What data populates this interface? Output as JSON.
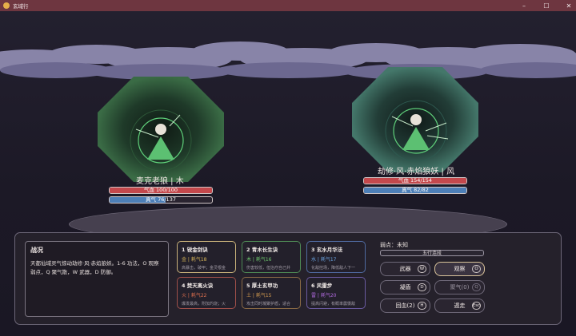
{
  "window": {
    "title": "玄域行",
    "minimize": "–",
    "maximize": "☐",
    "close": "✕"
  },
  "player": {
    "name": "麦克老狼 | 木",
    "hp_text": "气血 100/100",
    "hp_fraction": 1.0,
    "qi_text": "真气 76/137",
    "qi_fraction": 0.55,
    "hp_color": "#c3484c",
    "qi_color": "#4d7fb7",
    "aura_color": "#315b3d"
  },
  "enemy": {
    "name": "劫修·风·赤焰狼妖 | 风",
    "hp_text": "气血 154/154",
    "hp_fraction": 1.0,
    "qi_text": "真气 82/82",
    "qi_fraction": 1.0,
    "hp_color": "#c3484c",
    "qi_color": "#4d7fb7",
    "aura_color": "#3c6a60"
  },
  "log": {
    "title": "战况",
    "text": "天都仙域灵气惊动劫修·风·赤焰狼妖。1-6 功法，O 观察弱点，Q 聚气散，W 武器，D 防御。"
  },
  "skills": [
    {
      "name": "1 锐金剑诀",
      "cost": "金 | 耗气18",
      "desc": "高暴击，破甲；金灵根金",
      "cost_color": "#d8b65a",
      "border": "#c9b27a"
    },
    {
      "name": "2 青木长生诀",
      "cost": "木 | 耗气16",
      "desc": "伤害较低，但治疗自己并",
      "cost_color": "#6fca6f",
      "border": "#4e8a55"
    },
    {
      "name": "3 玄水月华法",
      "cost": "水 | 耗气17",
      "desc": "化敌控场，降低敌人下一",
      "cost_color": "#6aa3e0",
      "border": "#4f6aa0"
    },
    {
      "name": "4 焚天离火诀",
      "cost": "火 | 耗气22",
      "desc": "爆发最高，附加灼烧；火",
      "cost_color": "#e0704f",
      "border": "#a0504a"
    },
    {
      "name": "5 厚土玄甲功",
      "cost": "土 | 耗气15",
      "desc": "攻击同时凝聚护盾，适合",
      "cost_color": "#d39a4f",
      "border": "#8a6a45"
    },
    {
      "name": "6 风雷步",
      "cost": "雷 | 耗气20",
      "desc": "提高闪避，有概率震慑敌",
      "cost_color": "#b06adf",
      "border": "#6a5aa0"
    }
  ],
  "weak_point": {
    "label": "弱点：未知",
    "slot": "五行连段"
  },
  "actions": [
    {
      "label": "武器",
      "key": "W"
    },
    {
      "label": "观察",
      "key": "O"
    },
    {
      "label": "凝盾",
      "key": "D"
    },
    {
      "label": "聚气(0)",
      "key": "Q"
    },
    {
      "label": "回血(2)",
      "key": "H"
    },
    {
      "label": "遁走",
      "key": "Esc"
    }
  ]
}
